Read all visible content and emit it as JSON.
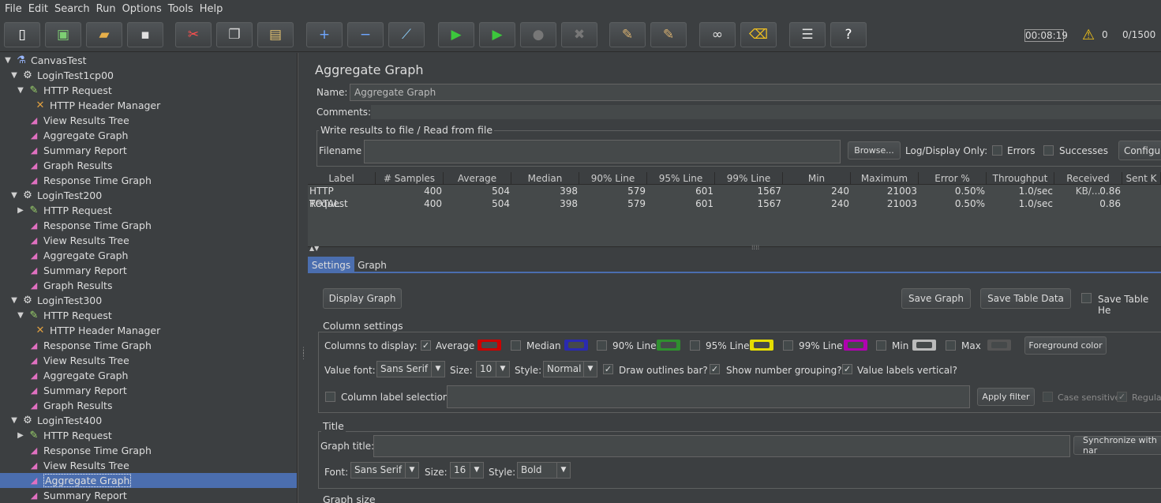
{
  "menu": [
    "File",
    "Edit",
    "Search",
    "Run",
    "Options",
    "Tools",
    "Help"
  ],
  "toolbar": {
    "buttons": [
      {
        "name": "new-icon",
        "glyph": "▯",
        "color": "#ffffff"
      },
      {
        "name": "templates-icon",
        "glyph": "▣",
        "color": "#7dcf73"
      },
      {
        "name": "open-icon",
        "glyph": "▰",
        "color": "#e8b04a"
      },
      {
        "name": "save-icon",
        "glyph": "▪",
        "color": "#e0e0e0"
      },
      {
        "name": "cut-icon",
        "glyph": "✂",
        "color": "#ff4f4f"
      },
      {
        "name": "copy-icon",
        "glyph": "❐",
        "color": "#d8d8d8"
      },
      {
        "name": "paste-icon",
        "glyph": "▤",
        "color": "#e0c070"
      },
      {
        "name": "expand-icon",
        "glyph": "+",
        "color": "#6ea6ff"
      },
      {
        "name": "collapse-icon",
        "glyph": "−",
        "color": "#6ea6ff"
      },
      {
        "name": "toggle-icon",
        "glyph": "⟋",
        "color": "#8fd3ff"
      },
      {
        "name": "start-icon",
        "glyph": "▶",
        "color": "#3cc83c"
      },
      {
        "name": "start-no-pauses-icon",
        "glyph": "▶",
        "color": "#3cc83c"
      },
      {
        "name": "stop-icon",
        "glyph": "●",
        "color": "#777777"
      },
      {
        "name": "shutdown-icon",
        "glyph": "✖",
        "color": "#777777"
      },
      {
        "name": "clear-icon",
        "glyph": "✎",
        "color": "#d8b070"
      },
      {
        "name": "clear-all-icon",
        "glyph": "✎",
        "color": "#d8b070"
      },
      {
        "name": "search-icon",
        "glyph": "∞",
        "color": "#e0e0e0"
      },
      {
        "name": "reset-search-icon",
        "glyph": "⌫",
        "color": "#f0c020"
      },
      {
        "name": "function-helper-icon",
        "glyph": "☰",
        "color": "#e0e0e0"
      },
      {
        "name": "help-icon",
        "glyph": "?",
        "color": "#ffffff"
      }
    ],
    "timer": "00:08:19",
    "warning_count": "0",
    "threads": "0/1500"
  },
  "tree": [
    {
      "label": "CanvasTest",
      "icon": "flask",
      "level": 0,
      "expander": "▼"
    },
    {
      "label": "LoginTest1cp00",
      "icon": "gear",
      "level": 1,
      "expander": "▼"
    },
    {
      "label": "HTTP Request",
      "icon": "pen",
      "level": 2,
      "expander": "▼"
    },
    {
      "label": "HTTP Header Manager",
      "icon": "wrench",
      "level": 3,
      "expander": ""
    },
    {
      "label": "View Results Tree",
      "icon": "graph",
      "level": 2,
      "expander": ""
    },
    {
      "label": "Aggregate Graph",
      "icon": "graph",
      "level": 2,
      "expander": ""
    },
    {
      "label": "Summary Report",
      "icon": "graph",
      "level": 2,
      "expander": ""
    },
    {
      "label": "Graph Results",
      "icon": "graph",
      "level": 2,
      "expander": ""
    },
    {
      "label": "Response Time Graph",
      "icon": "graph",
      "level": 2,
      "expander": ""
    },
    {
      "label": "LoginTest200",
      "icon": "gear",
      "level": 1,
      "expander": "▼"
    },
    {
      "label": "HTTP Request",
      "icon": "pen",
      "level": 2,
      "expander": "▶"
    },
    {
      "label": "Response Time Graph",
      "icon": "graph",
      "level": 2,
      "expander": ""
    },
    {
      "label": "View Results Tree",
      "icon": "graph",
      "level": 2,
      "expander": ""
    },
    {
      "label": "Aggregate Graph",
      "icon": "graph",
      "level": 2,
      "expander": ""
    },
    {
      "label": "Summary Report",
      "icon": "graph",
      "level": 2,
      "expander": ""
    },
    {
      "label": "Graph Results",
      "icon": "graph",
      "level": 2,
      "expander": ""
    },
    {
      "label": "LoginTest300",
      "icon": "gear",
      "level": 1,
      "expander": "▼"
    },
    {
      "label": "HTTP Request",
      "icon": "pen",
      "level": 2,
      "expander": "▼"
    },
    {
      "label": "HTTP Header Manager",
      "icon": "wrench",
      "level": 3,
      "expander": ""
    },
    {
      "label": "Response Time Graph",
      "icon": "graph",
      "level": 2,
      "expander": ""
    },
    {
      "label": "View Results Tree",
      "icon": "graph",
      "level": 2,
      "expander": ""
    },
    {
      "label": "Aggregate Graph",
      "icon": "graph",
      "level": 2,
      "expander": ""
    },
    {
      "label": "Summary Report",
      "icon": "graph",
      "level": 2,
      "expander": ""
    },
    {
      "label": "Graph Results",
      "icon": "graph",
      "level": 2,
      "expander": ""
    },
    {
      "label": "LoginTest400",
      "icon": "gear",
      "level": 1,
      "expander": "▼"
    },
    {
      "label": "HTTP Request",
      "icon": "pen",
      "level": 2,
      "expander": "▶"
    },
    {
      "label": "Response Time Graph",
      "icon": "graph",
      "level": 2,
      "expander": ""
    },
    {
      "label": "View Results Tree",
      "icon": "graph",
      "level": 2,
      "expander": ""
    },
    {
      "label": "Aggregate Graph",
      "icon": "graph",
      "level": 2,
      "expander": "",
      "selected": true
    },
    {
      "label": "Summary Report",
      "icon": "graph",
      "level": 2,
      "expander": ""
    }
  ],
  "panel": {
    "title": "Aggregate Graph",
    "name_label": "Name:",
    "name_value": "Aggregate Graph",
    "comments_label": "Comments:",
    "write_results_title": "Write results to file / Read from file",
    "filename_label": "Filename",
    "browse_label": "Browse...",
    "log_display_label": "Log/Display Only:",
    "errors_label": "Errors",
    "successes_label": "Successes",
    "configure_label": "Configu"
  },
  "table": {
    "columns": [
      "Label",
      "# Samples",
      "Average",
      "Median",
      "90% Line",
      "95% Line",
      "99% Line",
      "Min",
      "Maximum",
      "Error %",
      "Throughput",
      "Received KB/...",
      "Sent K"
    ],
    "rows": [
      [
        "HTTP Request",
        "400",
        "504",
        "398",
        "579",
        "601",
        "1567",
        "240",
        "21003",
        "0.50%",
        "1.0/sec",
        "0.86",
        ""
      ],
      [
        "TOTAL",
        "400",
        "504",
        "398",
        "579",
        "601",
        "1567",
        "240",
        "21003",
        "0.50%",
        "1.0/sec",
        "0.86",
        ""
      ]
    ]
  },
  "tabs": [
    "Settings",
    "Graph"
  ],
  "settings": {
    "display_graph": "Display Graph",
    "save_graph": "Save Graph",
    "save_table_data": "Save Table Data",
    "save_table_header": "Save Table He",
    "column_settings_title": "Column settings",
    "columns_to_display_label": "Columns to display:",
    "columns": [
      {
        "label": "Average",
        "checked": true,
        "color": "#cc0000"
      },
      {
        "label": "Median",
        "checked": false,
        "color": "#2a2ab0"
      },
      {
        "label": "90% Line",
        "checked": false,
        "color": "#2f8f2f"
      },
      {
        "label": "95% Line",
        "checked": false,
        "color": "#e5dd00"
      },
      {
        "label": "99% Line",
        "checked": false,
        "color": "#b000b0"
      },
      {
        "label": "Min",
        "checked": false,
        "color": "#bbbbbb"
      },
      {
        "label": "Max",
        "checked": false,
        "color": "#555555"
      }
    ],
    "foreground_color": "Foreground color",
    "value_font_label": "Value font:",
    "value_font": "Sans Serif",
    "size_label": "Size:",
    "value_size": "10",
    "style_label": "Style:",
    "value_style": "Normal",
    "draw_outlines": "Draw outlines bar?",
    "show_grouping": "Show number grouping?",
    "labels_vertical": "Value labels vertical?",
    "column_label_selection": "Column label selection:",
    "apply_filter": "Apply filter",
    "case_sensitive": "Case sensitive",
    "regular": "Regula",
    "title_group": "Title",
    "graph_title_label": "Graph title:",
    "sync_label": "Synchronize with nar",
    "font_label": "Font:",
    "title_font": "Sans Serif",
    "title_size": "16",
    "title_style": "Bold",
    "graph_size_title": "Graph size"
  }
}
